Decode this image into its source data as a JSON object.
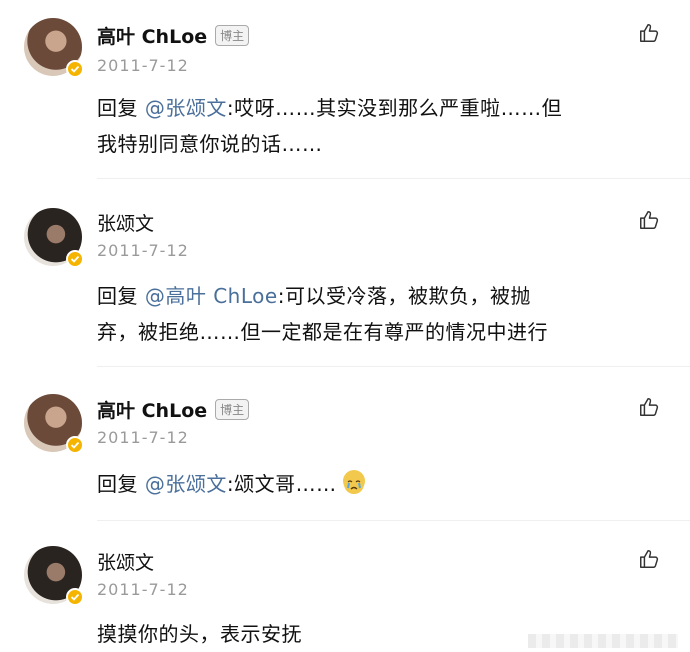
{
  "comments": [
    {
      "author": "高叶 ChLoe",
      "tag": "博主",
      "date": "2011-7-12",
      "reply_prefix": "回复 ",
      "mention": "@张颂文",
      "line1_rest": ":哎呀……其实没到那么严重啦……但",
      "line2": "我特别同意你说的话……"
    },
    {
      "author": "张颂文",
      "date": "2011-7-12",
      "reply_prefix": "回复 ",
      "mention": "@高叶 ChLoe",
      "line1_rest": ":可以受冷落，被欺负，被抛",
      "line2": "弃，被拒绝……但一定都是在有尊严的情况中进行"
    },
    {
      "author": "高叶 ChLoe",
      "tag": "博主",
      "date": "2011-7-12",
      "reply_prefix": "回复 ",
      "mention": "@张颂文",
      "line1_rest": ":颂文哥……"
    },
    {
      "author": "张颂文",
      "date": "2011-7-12",
      "line1_rest": "摸摸你的头，表示安抚"
    }
  ],
  "icons": {
    "like": "thumbs-up-icon",
    "verified": "verified-badge-icon",
    "emoji": "crying-face-emoji"
  },
  "colors": {
    "mention": "#4a6f9a",
    "verified": "#f5b400",
    "date": "#9a9a9a"
  }
}
